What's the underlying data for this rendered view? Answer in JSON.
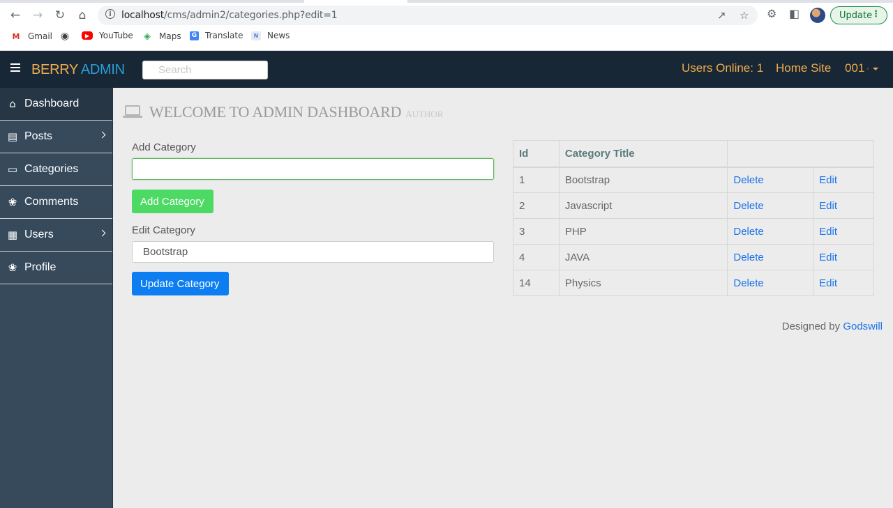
{
  "browser": {
    "url_host": "localhost",
    "url_path": "/cms/admin2/categories.php?edit=1",
    "update_label": "Update",
    "bookmarks": [
      {
        "label": "Gmail",
        "icon": "gmail-icon"
      },
      {
        "label": "",
        "icon": "globe-icon"
      },
      {
        "label": "YouTube",
        "icon": "youtube-icon"
      },
      {
        "label": "Maps",
        "icon": "maps-icon"
      },
      {
        "label": "Translate",
        "icon": "translate-icon"
      },
      {
        "label": "News",
        "icon": "news-icon"
      }
    ]
  },
  "header": {
    "brand_part1": "BERRY",
    "brand_part2": "ADMIN",
    "search_placeholder": "Search",
    "users_online": "Users Online: 1",
    "home_site": "Home Site",
    "user": "001",
    "colors": {
      "bar": "#182735",
      "accent": "#f0ad4e",
      "brand_blue": "#2a9fd6"
    }
  },
  "sidebar": {
    "items": [
      {
        "label": "Dashboard",
        "icon": "home-icon",
        "active": true,
        "has_submenu": false
      },
      {
        "label": "Posts",
        "icon": "document-icon",
        "active": false,
        "has_submenu": true
      },
      {
        "label": "Categories",
        "icon": "monitor-icon",
        "active": false,
        "has_submenu": false
      },
      {
        "label": "Comments",
        "icon": "atom-icon",
        "active": false,
        "has_submenu": false
      },
      {
        "label": "Users",
        "icon": "table-icon",
        "active": false,
        "has_submenu": true
      },
      {
        "label": "Profile",
        "icon": "atom-icon",
        "active": false,
        "has_submenu": false
      }
    ]
  },
  "main": {
    "title": "WELCOME TO ADMIN DASHBOARD",
    "subtitle": "AUTHOR",
    "add_form": {
      "label": "Add Category",
      "value": "",
      "button": "Add Category"
    },
    "edit_form": {
      "label": "Edit Category",
      "value": "Bootstrap",
      "button": "Update Category"
    },
    "table": {
      "headers": [
        "Id",
        "Category Title",
        ""
      ],
      "rows": [
        {
          "id": "1",
          "title": "Bootstrap",
          "delete": "Delete",
          "edit": "Edit"
        },
        {
          "id": "2",
          "title": "Javascript",
          "delete": "Delete",
          "edit": "Edit"
        },
        {
          "id": "3",
          "title": "PHP",
          "delete": "Delete",
          "edit": "Edit"
        },
        {
          "id": "4",
          "title": "JAVA",
          "delete": "Delete",
          "edit": "Edit"
        },
        {
          "id": "14",
          "title": "Physics",
          "delete": "Delete",
          "edit": "Edit"
        }
      ]
    },
    "footer": {
      "text": "Designed by",
      "author": "Godswill"
    }
  }
}
